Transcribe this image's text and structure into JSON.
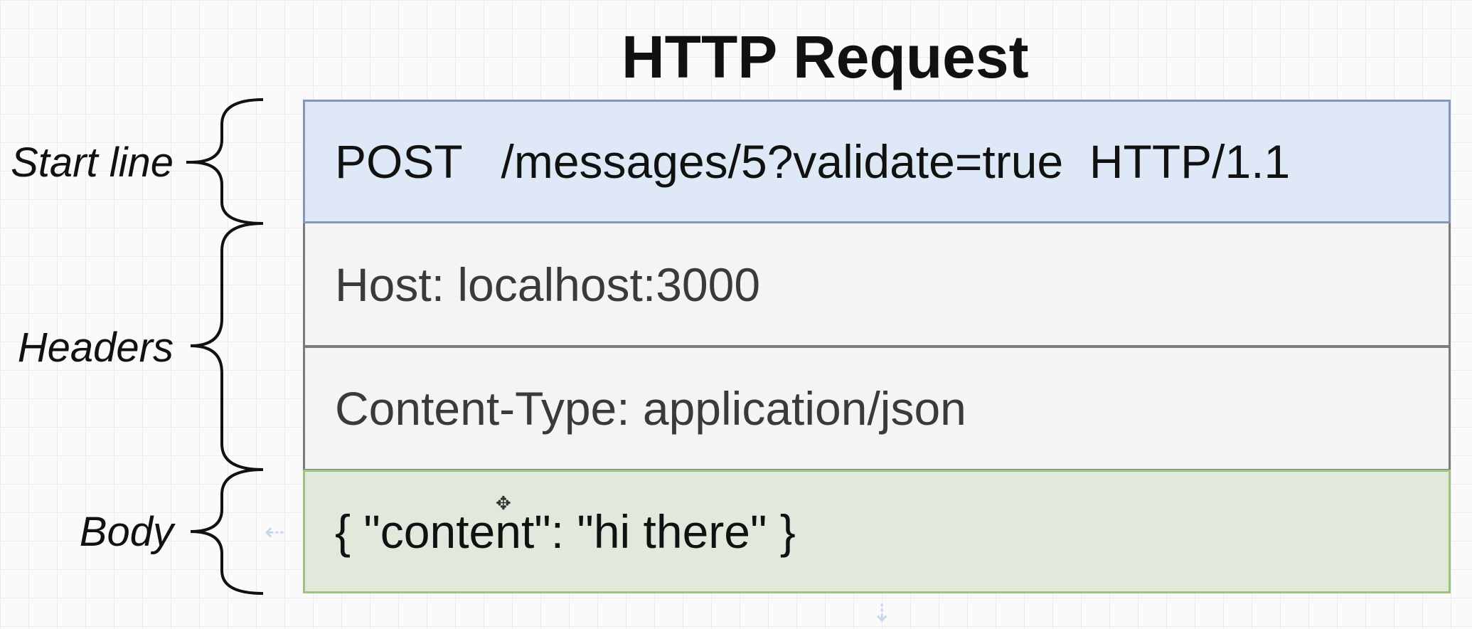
{
  "title": "HTTP Request",
  "labels": {
    "start_line": "Start line",
    "headers": "Headers",
    "body": "Body"
  },
  "rows": {
    "start_line": "POST   /messages/5?validate=true  HTTP/1.1",
    "header_host": "Host: localhost:3000",
    "header_content_type": "Content-Type: application/json",
    "body": "{ \"content\": \"hi there\" }"
  },
  "colors": {
    "start_line_fill": "#dfe8f6",
    "start_line_border": "#8497b9",
    "header_fill": "#f4f4f4",
    "header_border": "#7a7a7a",
    "body_fill": "#e1e9dc",
    "body_border": "#9cc383"
  }
}
